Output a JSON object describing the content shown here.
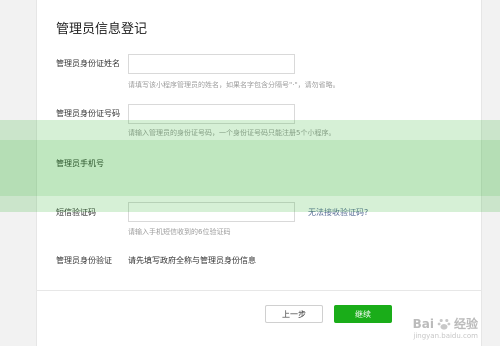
{
  "form": {
    "title": "管理员信息登记",
    "name_label": "管理员身份证姓名",
    "name_value": "",
    "name_hint": "请填写该小程序管理员的姓名，如果名字包含分隔号\"·\"，请勿省略。",
    "id_label": "管理员身份证号码",
    "id_value": "",
    "id_hint": "请输入管理员的身份证号码，一个身份证号码只能注册5个小程序。",
    "phone_label": "管理员手机号",
    "sms_label": "短信验证码",
    "sms_value": "",
    "sms_link": "无法接收验证码?",
    "sms_hint": "请输入手机短信收到的6位验证码",
    "verify_label": "管理员身份验证",
    "verify_text": "请先填写政府全称与管理员身份信息"
  },
  "buttons": {
    "prev": "上一步",
    "next": "继续"
  },
  "watermark": {
    "brand": "Bai",
    "brand_cn": "经验",
    "url": "jingyan.baidu.com"
  },
  "colors": {
    "accent": "#1aad19",
    "link": "#576b95"
  }
}
